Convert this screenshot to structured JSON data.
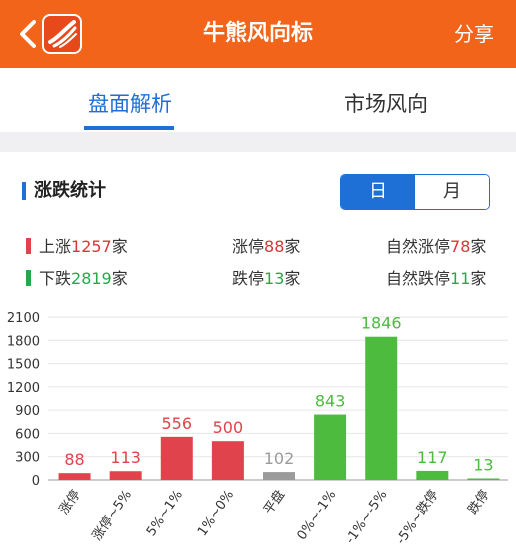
{
  "header": {
    "title": "牛熊风向标",
    "share": "分享"
  },
  "tabs": [
    {
      "label": "盘面解析"
    },
    {
      "label": "市场风向"
    }
  ],
  "section": {
    "title": "涨跌统计",
    "segments": [
      {
        "label": "日"
      },
      {
        "label": "月"
      }
    ]
  },
  "stats": {
    "up": {
      "prefix": "上涨",
      "value": "1257",
      "suffix": "家"
    },
    "limit_up": {
      "prefix": "涨停",
      "value": "88",
      "suffix": "家"
    },
    "natural_limit_up": {
      "prefix": "自然涨停",
      "value": "78",
      "suffix": "家"
    },
    "down": {
      "prefix": "下跌",
      "value": "2819",
      "suffix": "家"
    },
    "limit_down": {
      "prefix": "跌停",
      "value": "13",
      "suffix": "家"
    },
    "natural_limit_down": {
      "prefix": "自然跌停",
      "value": "11",
      "suffix": "家"
    }
  },
  "colors": {
    "accent": "#1e6fd6",
    "header": "#f2641a",
    "up": "#e0434b",
    "flat": "#9b9b9b",
    "down": "#4cbb3e"
  },
  "chart_data": {
    "type": "bar",
    "categories": [
      "涨停",
      "涨停~5%",
      "5%~1%",
      "1%~0%",
      "平盘",
      "0%~-1%",
      "-1%~-5%",
      "-5%~跌停",
      "跌停"
    ],
    "values": [
      88,
      113,
      556,
      500,
      102,
      843,
      1846,
      117,
      13
    ],
    "bar_colors": [
      "up",
      "up",
      "up",
      "up",
      "flat",
      "down",
      "down",
      "down",
      "down"
    ],
    "ylim": [
      0,
      2100
    ],
    "yticks": [
      0,
      300,
      600,
      900,
      1200,
      1500,
      1800,
      2100
    ],
    "grid": true
  }
}
